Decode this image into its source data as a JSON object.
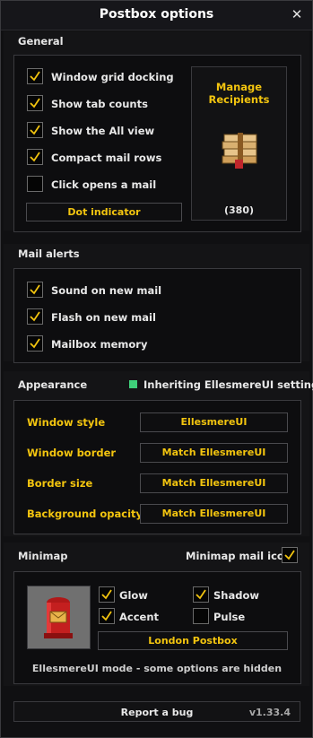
{
  "window": {
    "title": "Postbox options"
  },
  "general": {
    "label": "General",
    "checkboxes": [
      {
        "label": "Window grid docking",
        "checked": true
      },
      {
        "label": "Show tab counts",
        "checked": true
      },
      {
        "label": "Show the All view",
        "checked": true
      },
      {
        "label": "Compact mail rows",
        "checked": true
      },
      {
        "label": "Click opens a mail",
        "checked": false
      }
    ],
    "dot_indicator_label": "Dot indicator",
    "manage": {
      "title_line1": "Manage",
      "title_line2": "Recipients",
      "count": "(380)"
    }
  },
  "mail_alerts": {
    "label": "Mail alerts",
    "checkboxes": [
      {
        "label": "Sound on new mail",
        "checked": true
      },
      {
        "label": "Flash on new mail",
        "checked": true
      },
      {
        "label": "Mailbox memory",
        "checked": true
      }
    ]
  },
  "appearance": {
    "label": "Appearance",
    "status": "Inheriting EllesmereUI settings",
    "status_color": "#3fd07a",
    "rows": [
      {
        "label": "Window style",
        "value": "EllesmereUI"
      },
      {
        "label": "Window border",
        "value": "Match EllesmereUI"
      },
      {
        "label": "Border size",
        "value": "Match EllesmereUI"
      },
      {
        "label": "Background opacity",
        "value": "Match EllesmereUI"
      }
    ]
  },
  "minimap": {
    "label": "Minimap",
    "icon_toggle_label": "Minimap mail icon",
    "icon_toggle_checked": true,
    "checkboxes": [
      {
        "label": "Glow",
        "checked": true
      },
      {
        "label": "Shadow",
        "checked": true
      },
      {
        "label": "Accent",
        "checked": true
      },
      {
        "label": "Pulse",
        "checked": false
      }
    ],
    "style_button": "London Postbox",
    "note": "EllesmereUI mode - some options are hidden"
  },
  "footer": {
    "report_label": "Report a bug",
    "version": "v1.33.4"
  },
  "colors": {
    "accent": "#f2c40f",
    "check": "#f2c40f",
    "status_green": "#3fd07a"
  }
}
